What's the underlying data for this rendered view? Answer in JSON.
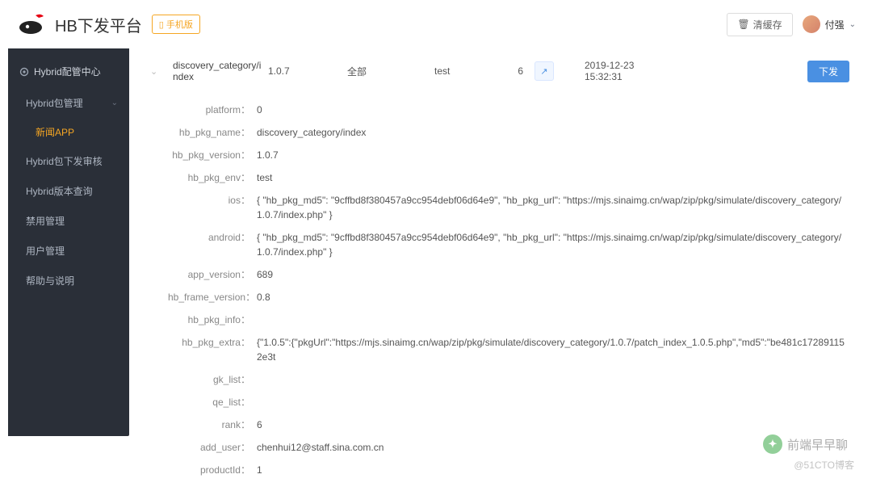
{
  "header": {
    "title": "HB下发平台",
    "mobile_btn": "手机版",
    "cache_btn": "清缓存",
    "user_name": "付强"
  },
  "sidebar": {
    "root": "Hybrid配管中心",
    "items": [
      {
        "label": "Hybrid包管理",
        "sub": [
          {
            "label": "新闻APP",
            "active": true
          }
        ]
      },
      {
        "label": "Hybrid包下发审核"
      },
      {
        "label": "Hybrid版本查询"
      },
      {
        "label": "禁用管理"
      },
      {
        "label": "用户管理"
      },
      {
        "label": "帮助与说明"
      }
    ]
  },
  "row": {
    "name": "discovery_category/index",
    "version": "1.0.7",
    "scope": "全部",
    "env": "test",
    "rank": "6",
    "time": "2019-12-23 15:32:31",
    "action": "下发"
  },
  "detail": {
    "platform": "0",
    "hb_pkg_name": "discovery_category/index",
    "hb_pkg_version": "1.0.7",
    "hb_pkg_env": "test",
    "ios": "{ \"hb_pkg_md5\": \"9cffbd8f380457a9cc954debf06d64e9\", \"hb_pkg_url\": \"https://mjs.sinaimg.cn/wap/zip/pkg/simulate/discovery_category/1.0.7/index.php\" }",
    "android": "{ \"hb_pkg_md5\": \"9cffbd8f380457a9cc954debf06d64e9\", \"hb_pkg_url\": \"https://mjs.sinaimg.cn/wap/zip/pkg/simulate/discovery_category/1.0.7/index.php\" }",
    "app_version": "689",
    "hb_frame_version": "0.8",
    "hb_pkg_info": "",
    "hb_pkg_extra": "{\"1.0.5\":{\"pkgUrl\":\"https://mjs.sinaimg.cn/wap/zip/pkg/simulate/discovery_category/1.0.7/patch_index_1.0.5.php\",\"md5\":\"be481c172891152e3t",
    "gk_list": "",
    "qe_list": "",
    "rank": "6",
    "add_user": "chenhui12@staff.sina.com.cn",
    "productId": "1"
  },
  "labels": {
    "platform": "platform",
    "hb_pkg_name": "hb_pkg_name",
    "hb_pkg_version": "hb_pkg_version",
    "hb_pkg_env": "hb_pkg_env",
    "ios": "ios",
    "android": "android",
    "app_version": "app_version",
    "hb_frame_version": "hb_frame_version",
    "hb_pkg_info": "hb_pkg_info",
    "hb_pkg_extra": "hb_pkg_extra",
    "gk_list": "gk_list",
    "qe_list": "qe_list",
    "rank": "rank",
    "add_user": "add_user",
    "productId": "productId"
  },
  "watermark": {
    "text1": "前端早早聊",
    "text2": "@51CTO博客"
  }
}
